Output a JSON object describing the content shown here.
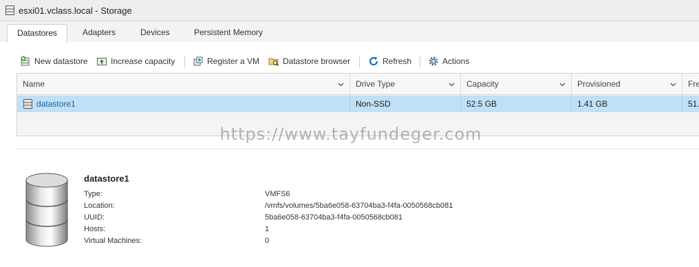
{
  "window": {
    "title": "esxi01.vclass.local - Storage",
    "icon": "server-storage-icon"
  },
  "tabs": [
    {
      "label": "Datastores",
      "active": true
    },
    {
      "label": "Adapters",
      "active": false
    },
    {
      "label": "Devices",
      "active": false
    },
    {
      "label": "Persistent Memory",
      "active": false
    }
  ],
  "toolbar": {
    "new_datastore": "New datastore",
    "increase_capacity": "Increase capacity",
    "register_vm": "Register a VM",
    "datastore_browser": "Datastore browser",
    "refresh": "Refresh",
    "actions": "Actions"
  },
  "grid": {
    "columns": [
      "Name",
      "Drive Type",
      "Capacity",
      "Provisioned",
      "Fre"
    ],
    "rows": [
      {
        "name": "datastore1",
        "drive_type": "Non-SSD",
        "capacity": "52.5 GB",
        "provisioned": "1.41 GB",
        "free": "51."
      }
    ],
    "selected_row_color": "#bfe0f6"
  },
  "watermark": "https://www.tayfundeger.com",
  "details": {
    "name": "datastore1",
    "properties": [
      {
        "label": "Type:",
        "value": "VMFS6"
      },
      {
        "label": "Location:",
        "value": "/vmfs/volumes/5ba6e058-63704ba3-f4fa-0050568cb081"
      },
      {
        "label": "UUID:",
        "value": "5ba6e058-63704ba3-f4fa-0050568cb081"
      },
      {
        "label": "Hosts:",
        "value": "1"
      },
      {
        "label": "Virtual Machines:",
        "value": "0"
      }
    ]
  }
}
